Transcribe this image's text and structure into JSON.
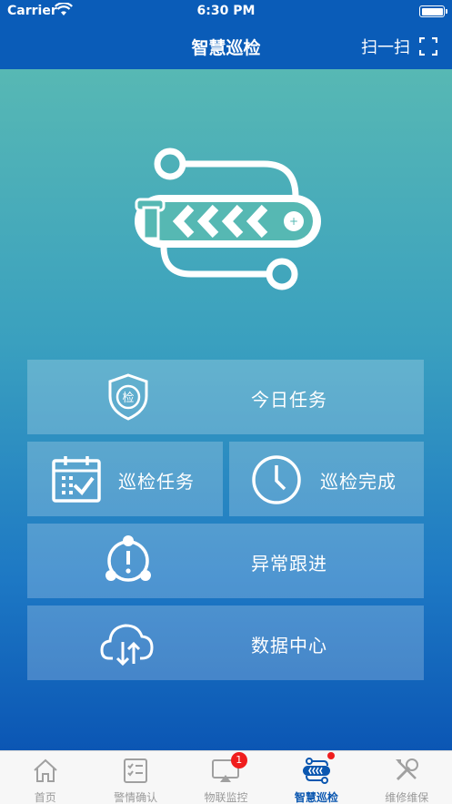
{
  "status_bar": {
    "carrier": "Carrier",
    "time": "6:30 PM"
  },
  "header": {
    "title": "智慧巡检",
    "scan_label": "扫一扫"
  },
  "logo": {
    "text": "i«««o"
  },
  "menu": {
    "today_tasks": "今日任务",
    "patrol_tasks": "巡检任务",
    "patrol_done": "巡检完成",
    "abnormal_follow": "异常跟进",
    "data_center": "数据中心",
    "shield_char": "检"
  },
  "tabbar": {
    "items": [
      {
        "label": "首页"
      },
      {
        "label": "警情确认"
      },
      {
        "label": "物联监控",
        "badge": "1"
      },
      {
        "label": "智慧巡检"
      },
      {
        "label": "维修维保"
      }
    ]
  },
  "colors": {
    "brand_blue": "#0a5cb8",
    "active_tab": "#0b57b0",
    "badge_red": "#f01d1d",
    "logo_teal": "#56b8b3"
  }
}
